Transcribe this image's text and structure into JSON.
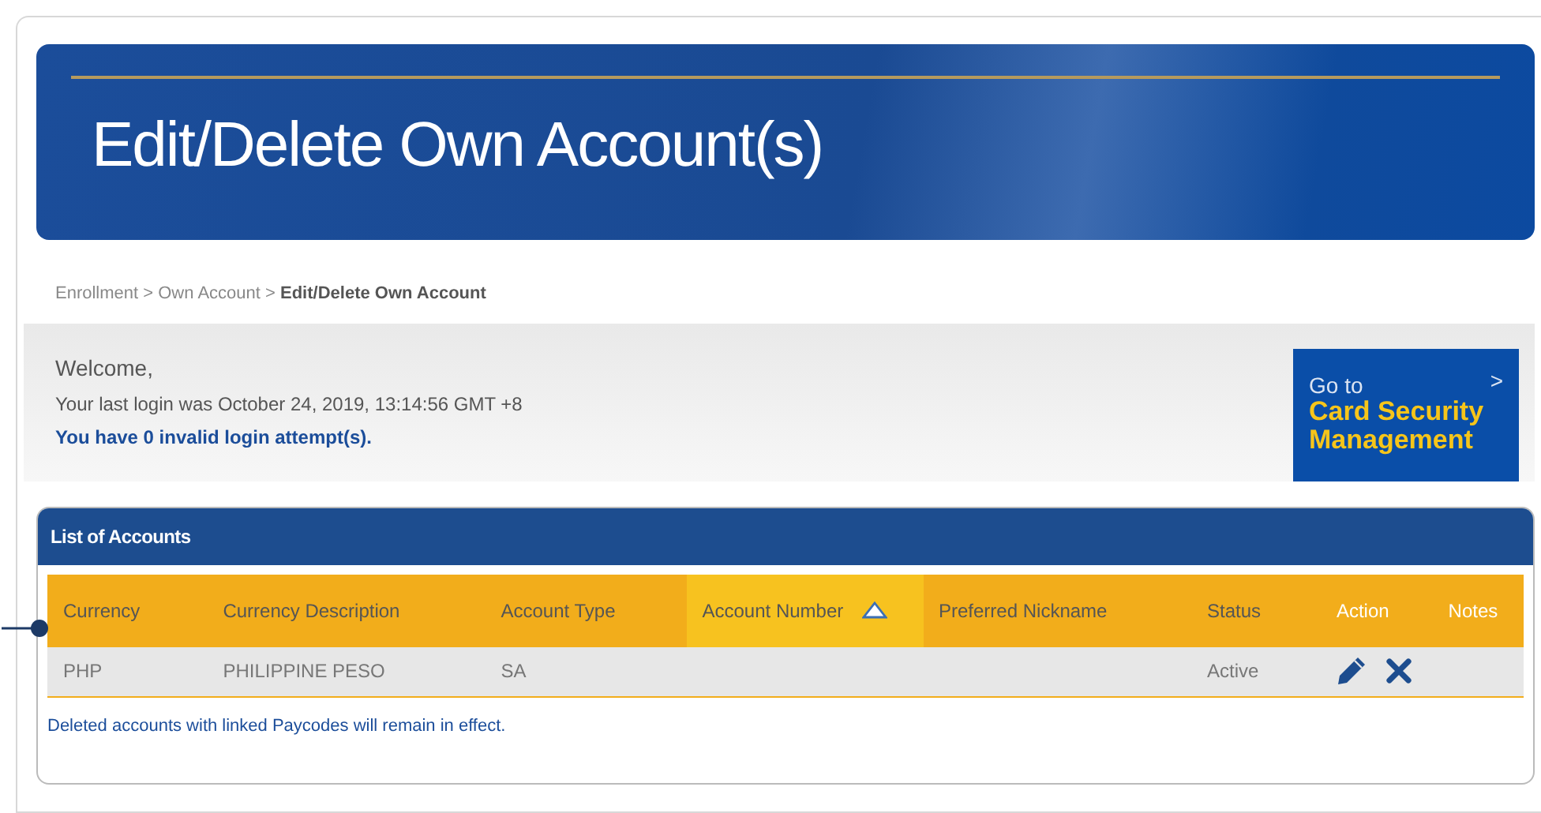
{
  "banner": {
    "title": "Edit/Delete Own Account(s)"
  },
  "breadcrumb": [
    {
      "label": "Enrollment",
      "current": false
    },
    {
      "label": "Own Account",
      "current": false
    },
    {
      "label": "Edit/Delete Own Account",
      "current": true
    }
  ],
  "breadcrumb_separator": ">",
  "welcome": {
    "greeting": "Welcome,",
    "last_login": "Your last login was October 24, 2019, 13:14:56 GMT +8",
    "attempts": "You have 0 invalid login attempt(s)."
  },
  "promo": {
    "line1": "Go to",
    "line2": "Card Security",
    "line3": "Management",
    "chevron": ">"
  },
  "accounts": {
    "title": "List of Accounts",
    "columns": [
      {
        "label": "Currency",
        "sorted": false,
        "kind": "data"
      },
      {
        "label": "Currency Description",
        "sorted": false,
        "kind": "data"
      },
      {
        "label": "Account Type",
        "sorted": false,
        "kind": "data"
      },
      {
        "label": "Account Number",
        "sorted": true,
        "kind": "data"
      },
      {
        "label": "Preferred Nickname",
        "sorted": false,
        "kind": "data"
      },
      {
        "label": "Status",
        "sorted": false,
        "kind": "data"
      },
      {
        "label": "Action",
        "sorted": false,
        "kind": "action"
      },
      {
        "label": "Notes",
        "sorted": false,
        "kind": "action"
      }
    ],
    "rows": [
      {
        "cells": [
          "PHP",
          "PHILIPPINE PESO",
          "SA",
          "",
          "",
          "Active"
        ]
      }
    ],
    "note": "Deleted accounts with linked Paycodes will remain in effect."
  }
}
